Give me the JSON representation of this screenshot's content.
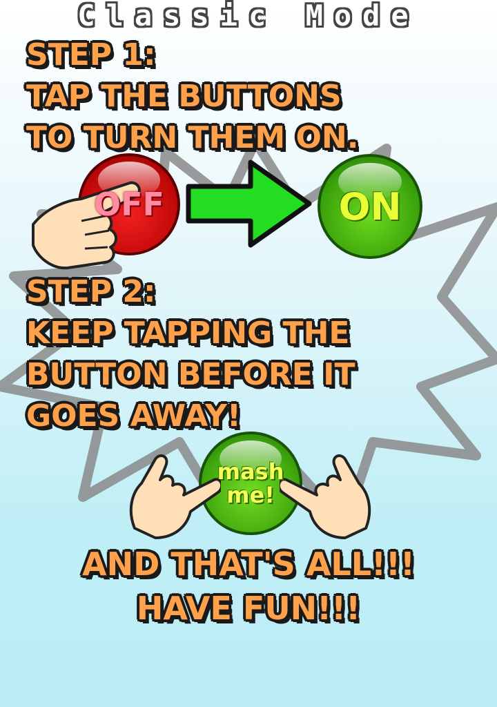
{
  "title": "Classic Mode",
  "step1": {
    "heading": "STEP 1:",
    "line1": "TAP THE BUTTONS",
    "line2": "TO TURN THEM ON."
  },
  "step2": {
    "heading": "STEP 2:",
    "line1": "KEEP TAPPING THE",
    "line2": "BUTTON BEFORE IT",
    "line3": "GOES AWAY!"
  },
  "buttons": {
    "off_label": "OFF",
    "on_label": "ON",
    "mash_label_line1": "mash",
    "mash_label_line2": "me!"
  },
  "closing": {
    "line1": "AND THAT'S ALL!!!",
    "line2": "HAVE FUN!!!"
  },
  "colors": {
    "text_fill": "#ffa04a",
    "text_outline": "#1a1a1a",
    "off_red": "#d81010",
    "on_green": "#3aa10b",
    "arrow_green": "#22dd22"
  },
  "icons": [
    "starburst-icon",
    "pointing-hand-icon",
    "arrow-right-icon"
  ]
}
